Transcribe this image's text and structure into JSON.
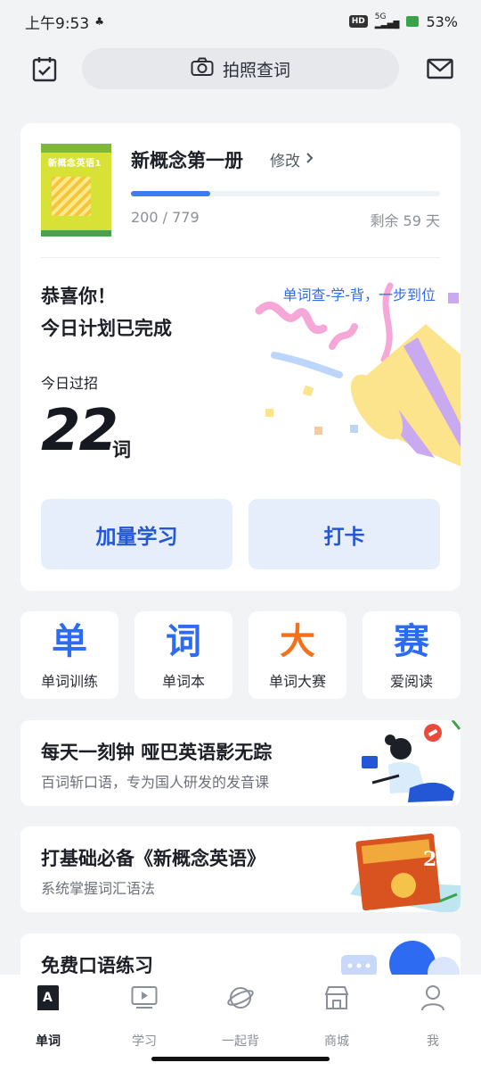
{
  "status": {
    "time": "上午9:53",
    "network": "5G",
    "hd": "HD",
    "battery": "53%"
  },
  "header": {
    "search_label": "拍照查词"
  },
  "book": {
    "cover_title": "新概念英语1",
    "title": "新概念第一册",
    "edit_label": "修改",
    "progress_text": "200 / 779",
    "progress_fraction": 0.257,
    "remaining": "剩余 59 天"
  },
  "today": {
    "congrats_line1": "恭喜你！",
    "congrats_line2": "今日计划已完成",
    "slogan": "单词查-学-背，一步到位",
    "label": "今日过招",
    "count": "22",
    "unit": "词",
    "btn_more": "加量学习",
    "btn_checkin": "打卡"
  },
  "tiles": [
    {
      "glyph": "单",
      "label": "单词训练",
      "color": "#2d6cf2"
    },
    {
      "glyph": "词",
      "label": "单词本",
      "color": "#2d6cf2"
    },
    {
      "glyph": "大",
      "label": "单词大赛",
      "color": "#f2711c"
    },
    {
      "glyph": "赛",
      "label": "爱阅读",
      "color": "#2d6cf2"
    }
  ],
  "promos": [
    {
      "title": "每天一刻钟 哑巴英语影无踪",
      "subtitle": "百词斩口语，专为国人研发的发音课"
    },
    {
      "title": "打基础必备《新概念英语》",
      "subtitle": "系统掌握词汇语法"
    },
    {
      "title": "免费口语练习",
      "subtitle": ""
    }
  ],
  "tabs": [
    {
      "label": "单词",
      "icon": "book-a-icon"
    },
    {
      "label": "学习",
      "icon": "video-play-icon"
    },
    {
      "label": "一起背",
      "icon": "planet-icon"
    },
    {
      "label": "商城",
      "icon": "store-icon"
    },
    {
      "label": "我",
      "icon": "person-icon"
    }
  ]
}
